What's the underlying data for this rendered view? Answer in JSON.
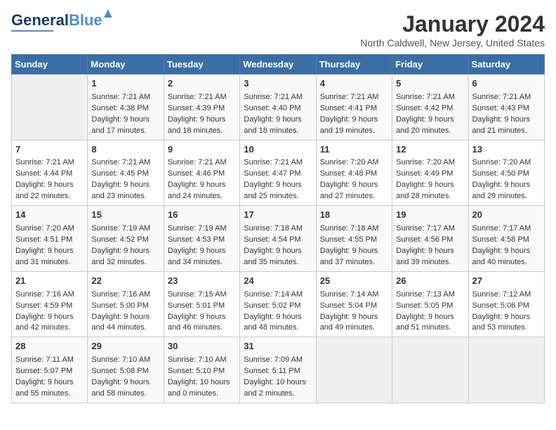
{
  "logo": {
    "general": "General",
    "blue": "Blue"
  },
  "title": "January 2024",
  "subtitle": "North Caldwell, New Jersey, United States",
  "weekdays": [
    "Sunday",
    "Monday",
    "Tuesday",
    "Wednesday",
    "Thursday",
    "Friday",
    "Saturday"
  ],
  "weeks": [
    [
      {
        "num": "",
        "empty": true
      },
      {
        "num": "1",
        "sunrise": "7:21 AM",
        "sunset": "4:38 PM",
        "daylight": "9 hours and 17 minutes."
      },
      {
        "num": "2",
        "sunrise": "7:21 AM",
        "sunset": "4:39 PM",
        "daylight": "9 hours and 18 minutes."
      },
      {
        "num": "3",
        "sunrise": "7:21 AM",
        "sunset": "4:40 PM",
        "daylight": "9 hours and 18 minutes."
      },
      {
        "num": "4",
        "sunrise": "7:21 AM",
        "sunset": "4:41 PM",
        "daylight": "9 hours and 19 minutes."
      },
      {
        "num": "5",
        "sunrise": "7:21 AM",
        "sunset": "4:42 PM",
        "daylight": "9 hours and 20 minutes."
      },
      {
        "num": "6",
        "sunrise": "7:21 AM",
        "sunset": "4:43 PM",
        "daylight": "9 hours and 21 minutes."
      }
    ],
    [
      {
        "num": "7",
        "sunrise": "7:21 AM",
        "sunset": "4:44 PM",
        "daylight": "9 hours and 22 minutes."
      },
      {
        "num": "8",
        "sunrise": "7:21 AM",
        "sunset": "4:45 PM",
        "daylight": "9 hours and 23 minutes."
      },
      {
        "num": "9",
        "sunrise": "7:21 AM",
        "sunset": "4:46 PM",
        "daylight": "9 hours and 24 minutes."
      },
      {
        "num": "10",
        "sunrise": "7:21 AM",
        "sunset": "4:47 PM",
        "daylight": "9 hours and 25 minutes."
      },
      {
        "num": "11",
        "sunrise": "7:20 AM",
        "sunset": "4:48 PM",
        "daylight": "9 hours and 27 minutes."
      },
      {
        "num": "12",
        "sunrise": "7:20 AM",
        "sunset": "4:49 PM",
        "daylight": "9 hours and 28 minutes."
      },
      {
        "num": "13",
        "sunrise": "7:20 AM",
        "sunset": "4:50 PM",
        "daylight": "9 hours and 29 minutes."
      }
    ],
    [
      {
        "num": "14",
        "sunrise": "7:20 AM",
        "sunset": "4:51 PM",
        "daylight": "9 hours and 31 minutes."
      },
      {
        "num": "15",
        "sunrise": "7:19 AM",
        "sunset": "4:52 PM",
        "daylight": "9 hours and 32 minutes."
      },
      {
        "num": "16",
        "sunrise": "7:19 AM",
        "sunset": "4:53 PM",
        "daylight": "9 hours and 34 minutes."
      },
      {
        "num": "17",
        "sunrise": "7:18 AM",
        "sunset": "4:54 PM",
        "daylight": "9 hours and 35 minutes."
      },
      {
        "num": "18",
        "sunrise": "7:18 AM",
        "sunset": "4:55 PM",
        "daylight": "9 hours and 37 minutes."
      },
      {
        "num": "19",
        "sunrise": "7:17 AM",
        "sunset": "4:56 PM",
        "daylight": "9 hours and 39 minutes."
      },
      {
        "num": "20",
        "sunrise": "7:17 AM",
        "sunset": "4:58 PM",
        "daylight": "9 hours and 40 minutes."
      }
    ],
    [
      {
        "num": "21",
        "sunrise": "7:16 AM",
        "sunset": "4:59 PM",
        "daylight": "9 hours and 42 minutes."
      },
      {
        "num": "22",
        "sunrise": "7:16 AM",
        "sunset": "5:00 PM",
        "daylight": "9 hours and 44 minutes."
      },
      {
        "num": "23",
        "sunrise": "7:15 AM",
        "sunset": "5:01 PM",
        "daylight": "9 hours and 46 minutes."
      },
      {
        "num": "24",
        "sunrise": "7:14 AM",
        "sunset": "5:02 PM",
        "daylight": "9 hours and 48 minutes."
      },
      {
        "num": "25",
        "sunrise": "7:14 AM",
        "sunset": "5:04 PM",
        "daylight": "9 hours and 49 minutes."
      },
      {
        "num": "26",
        "sunrise": "7:13 AM",
        "sunset": "5:05 PM",
        "daylight": "9 hours and 51 minutes."
      },
      {
        "num": "27",
        "sunrise": "7:12 AM",
        "sunset": "5:06 PM",
        "daylight": "9 hours and 53 minutes."
      }
    ],
    [
      {
        "num": "28",
        "sunrise": "7:11 AM",
        "sunset": "5:07 PM",
        "daylight": "9 hours and 55 minutes."
      },
      {
        "num": "29",
        "sunrise": "7:10 AM",
        "sunset": "5:08 PM",
        "daylight": "9 hours and 58 minutes."
      },
      {
        "num": "30",
        "sunrise": "7:10 AM",
        "sunset": "5:10 PM",
        "daylight": "10 hours and 0 minutes."
      },
      {
        "num": "31",
        "sunrise": "7:09 AM",
        "sunset": "5:11 PM",
        "daylight": "10 hours and 2 minutes."
      },
      {
        "num": "",
        "empty": true
      },
      {
        "num": "",
        "empty": true
      },
      {
        "num": "",
        "empty": true
      }
    ]
  ],
  "labels": {
    "sunrise": "Sunrise:",
    "sunset": "Sunset:",
    "daylight": "Daylight:"
  }
}
